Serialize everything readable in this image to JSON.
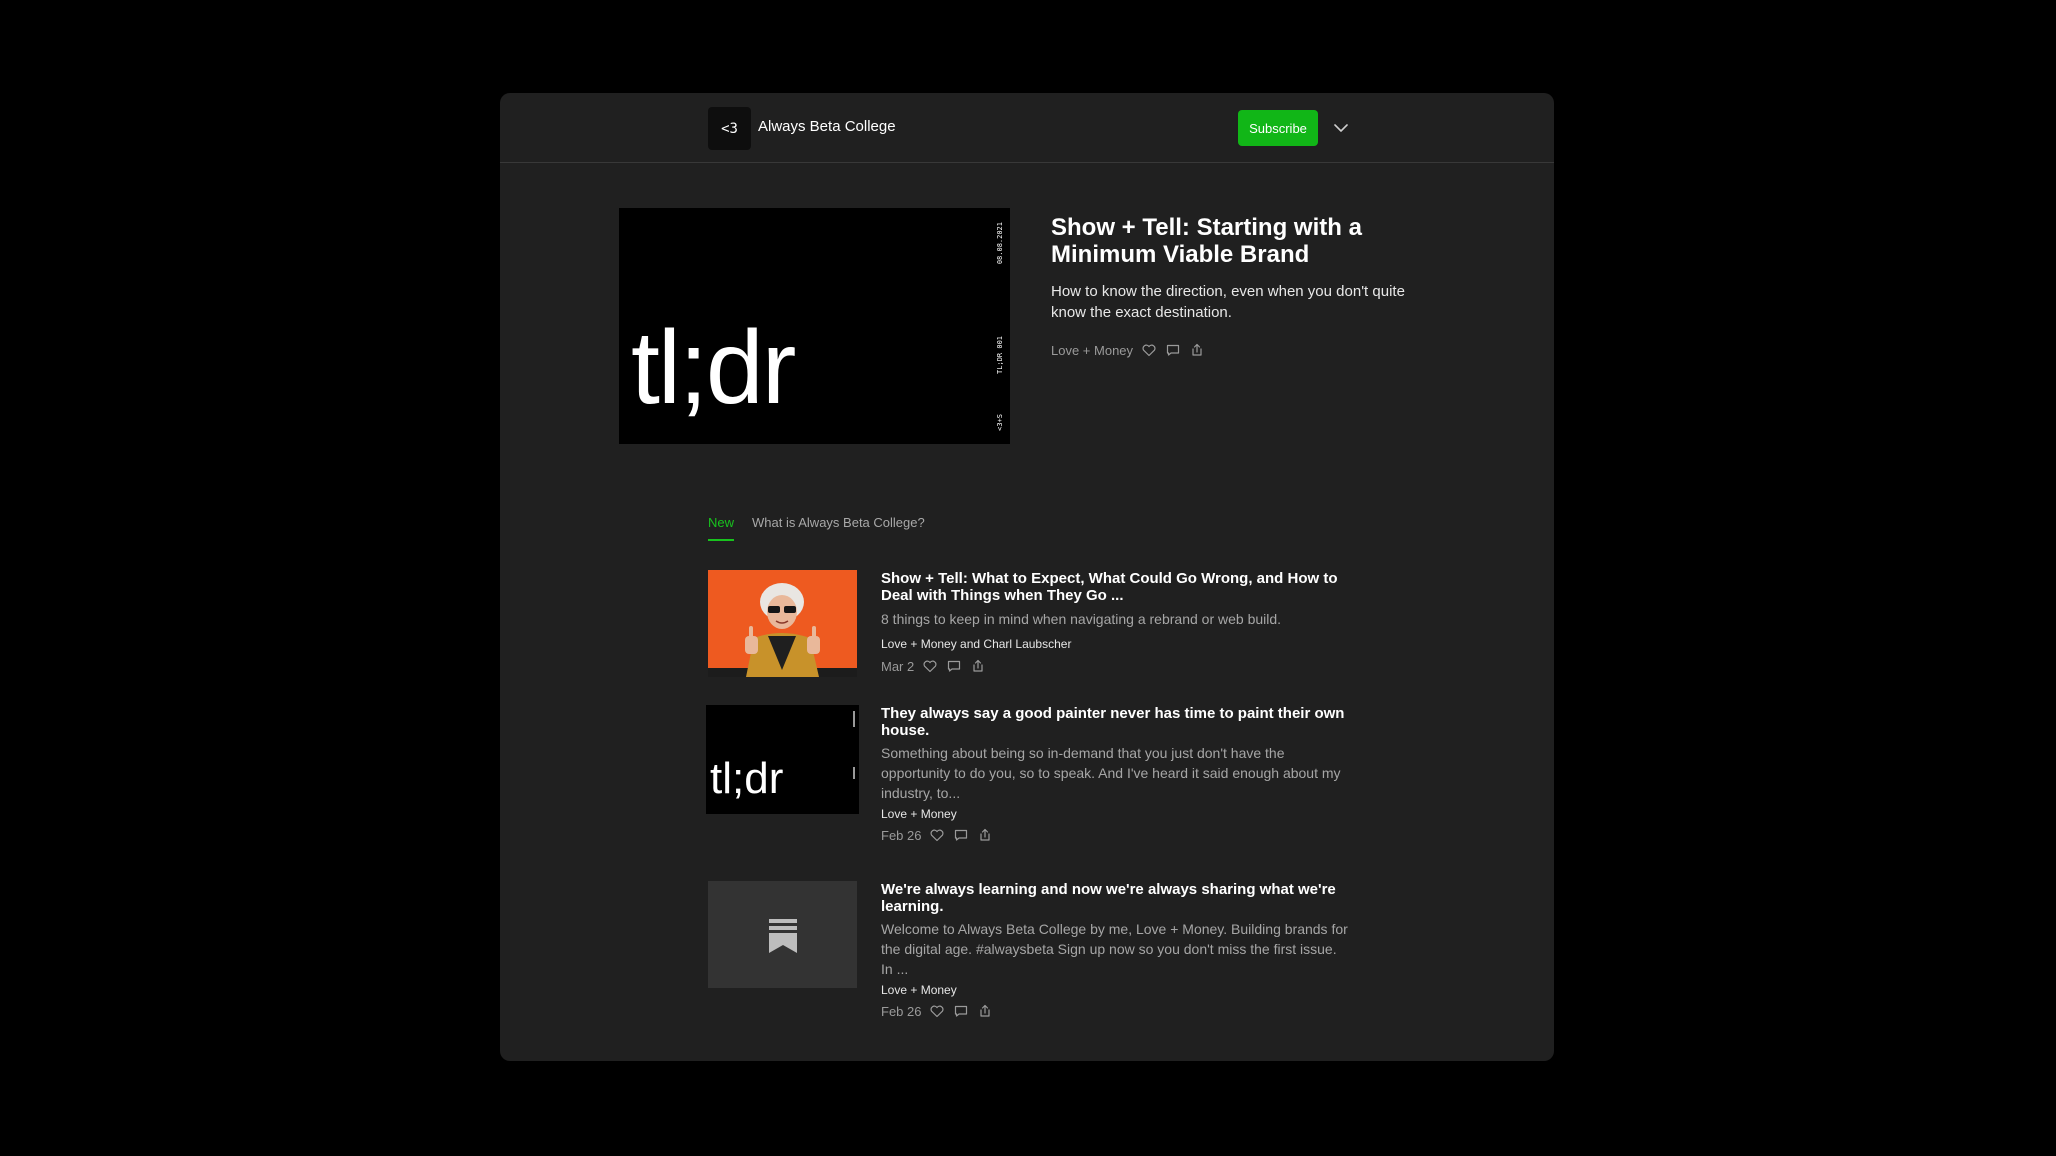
{
  "header": {
    "logo_text": "<3",
    "publication_name": "Always Beta College",
    "subscribe_label": "Subscribe"
  },
  "hero": {
    "image_text": "tl;dr",
    "image_side_texts": [
      "08.08.2021",
      "TL;DR 001",
      "<3+S"
    ],
    "title": "Show + Tell: Starting with a Minimum Viable Brand",
    "subtitle": "How to know the direction, even when you don't quite know the exact destination.",
    "author": "Love + Money"
  },
  "tabs": [
    {
      "label": "New",
      "active": true
    },
    {
      "label": "What is Always Beta College?",
      "active": false
    }
  ],
  "posts": [
    {
      "title": "Show + Tell: What to Expect, What Could Go Wrong, and How to Deal with Things when They Go ...",
      "description": "8 things to keep in mind when navigating a rebrand or web build.",
      "author": "Love + Money and Charl Laubscher",
      "date": "Mar 2",
      "thumb": "photo"
    },
    {
      "title": "They always say a good painter never has time to paint their own house.",
      "description": "Something about being so in-demand that you just don't have the opportunity to do you, so to speak. And I've heard it said enough about my industry, to...",
      "author": "Love + Money",
      "date": "Feb 26",
      "thumb_text": "tl;dr"
    },
    {
      "title": "We're always learning and now we're always sharing what we're learning.",
      "description": "Welcome to Always Beta College by me, Love + Money. Building brands for the digital age. #alwaysbeta Sign up now so you don't miss the first issue. In ...",
      "author": "Love + Money",
      "date": "Feb 26",
      "thumb": "placeholder"
    }
  ],
  "colors": {
    "accent": "#11b617",
    "background": "#202020",
    "page": "#000000"
  }
}
